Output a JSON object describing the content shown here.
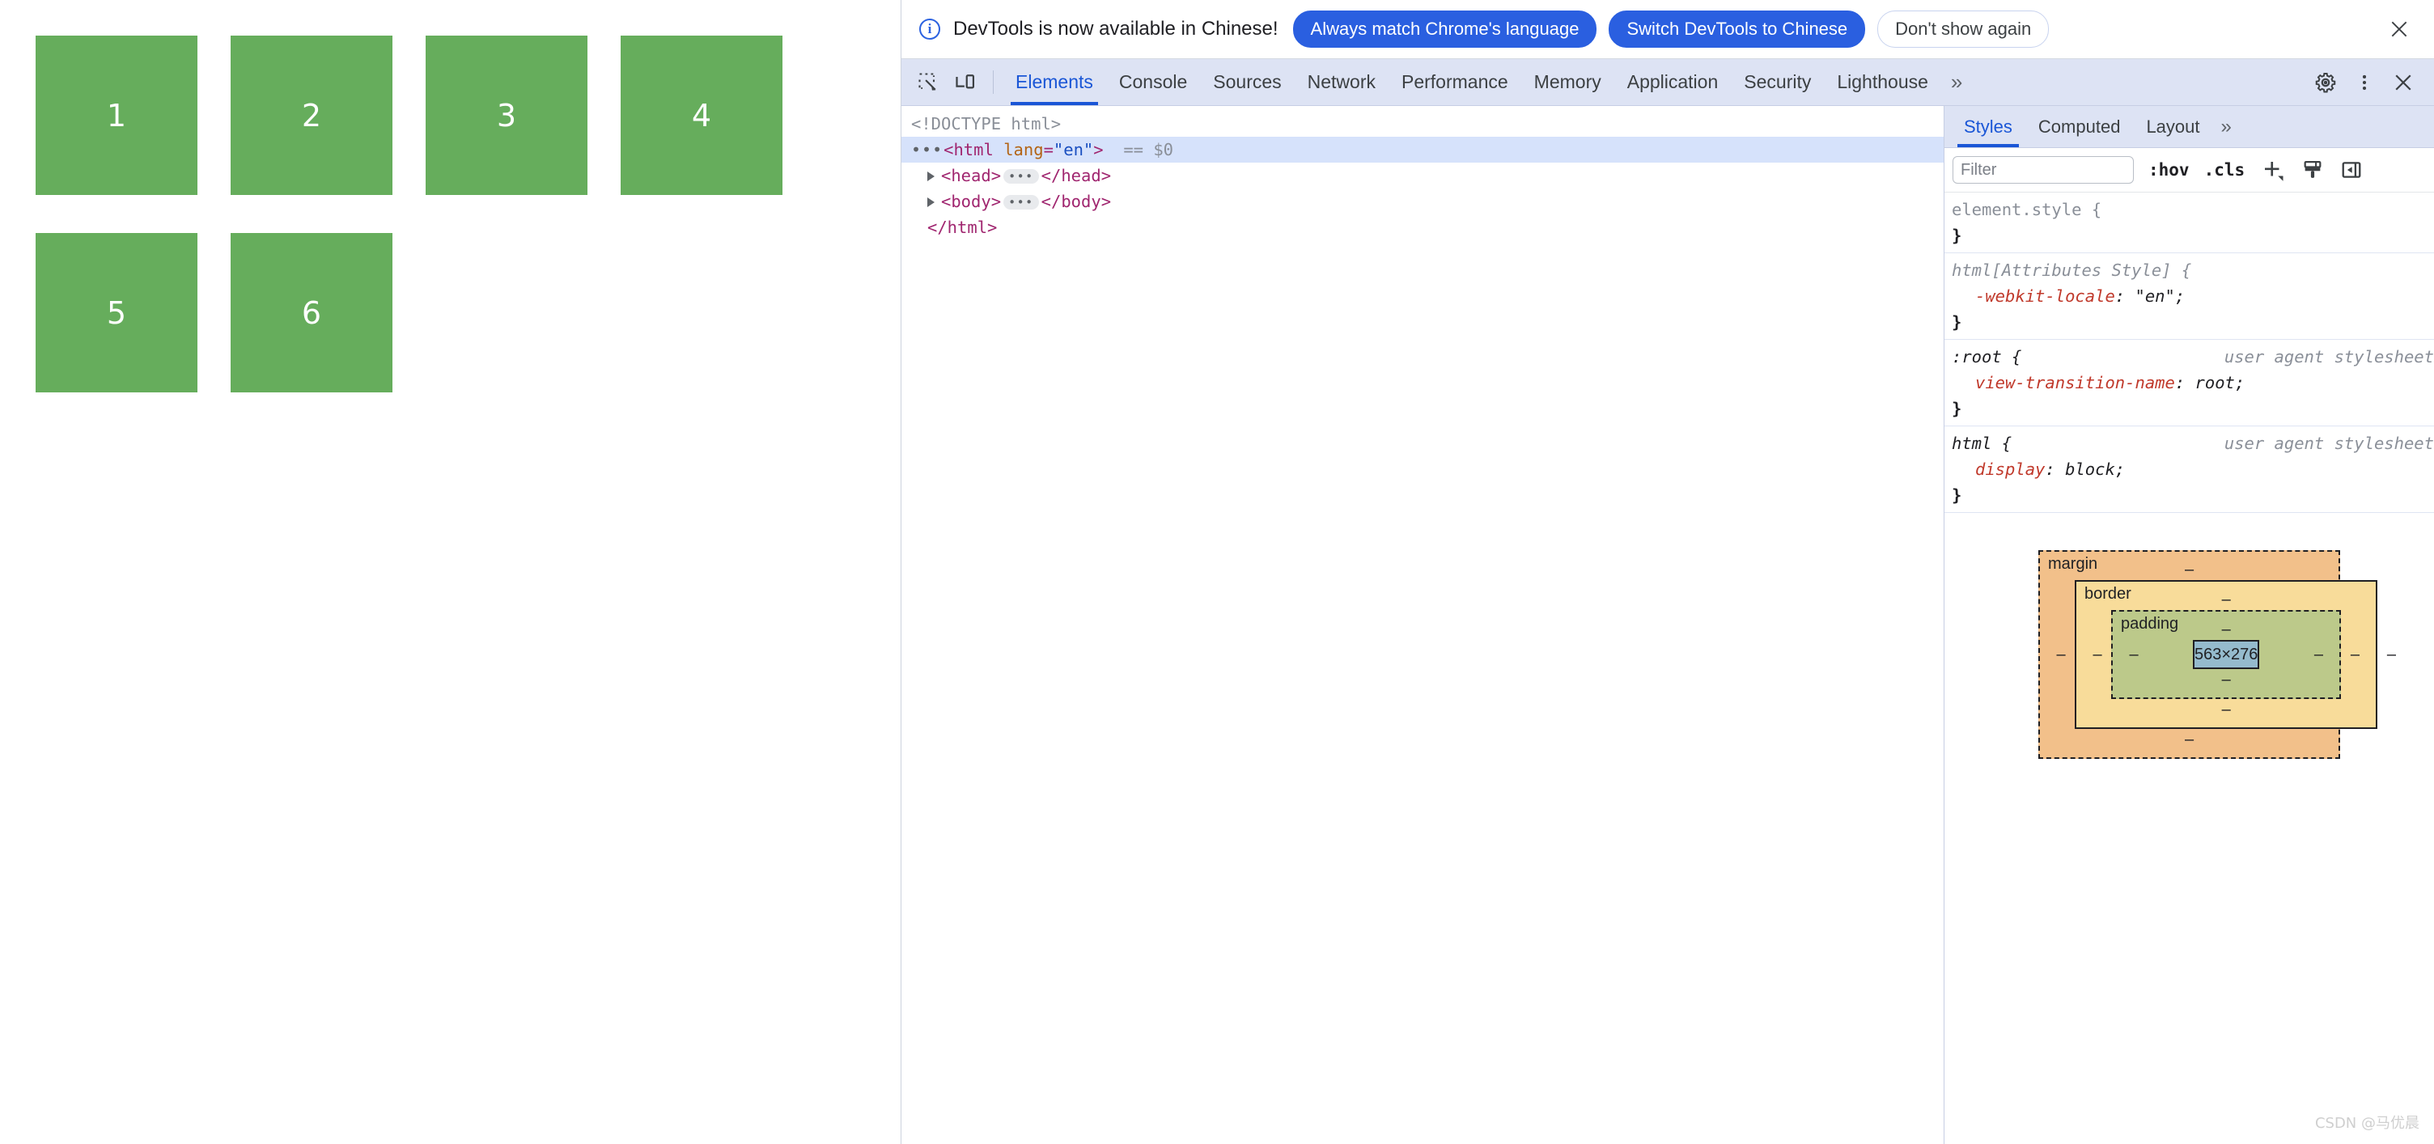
{
  "page": {
    "boxes": [
      {
        "label": "1"
      },
      {
        "label": "2"
      },
      {
        "label": "3"
      },
      {
        "label": "4"
      },
      {
        "label": "5"
      },
      {
        "label": "6"
      }
    ],
    "box_color": "#66ad5c",
    "box_text_color": "#ffffff"
  },
  "infobar": {
    "icon": "info-circle-icon",
    "message": "DevTools is now available in Chinese!",
    "primary_button_1": "Always match Chrome's language",
    "primary_button_2": "Switch DevTools to Chinese",
    "ghost_button": "Don't show again",
    "close_icon": "close-icon",
    "accent_color": "#2a5fe0"
  },
  "tabstrip": {
    "inspect_icon": "inspect-element-icon",
    "device_icon": "device-toolbar-icon",
    "tabs": [
      {
        "label": "Elements",
        "active": true
      },
      {
        "label": "Console",
        "active": false
      },
      {
        "label": "Sources",
        "active": false
      },
      {
        "label": "Network",
        "active": false
      },
      {
        "label": "Performance",
        "active": false
      },
      {
        "label": "Memory",
        "active": false
      },
      {
        "label": "Application",
        "active": false
      },
      {
        "label": "Security",
        "active": false
      },
      {
        "label": "Lighthouse",
        "active": false
      }
    ],
    "more_tabs": "»",
    "settings_icon": "gear-icon",
    "menu_icon": "more-vertical-icon",
    "close_icon": "close-icon",
    "active_color": "#1a56d6"
  },
  "dom": {
    "rows": [
      {
        "kind": "doctype",
        "text": "<!DOCTYPE html>"
      },
      {
        "kind": "selected_html",
        "dots": "•••",
        "open": "<html",
        "attr_name": "lang",
        "attr_value": "\"en\"",
        "close": ">",
        "suffix": "== $0"
      },
      {
        "kind": "element",
        "open": "<head>",
        "badge": "•••",
        "close": "</head>"
      },
      {
        "kind": "element",
        "open": "<body>",
        "badge": "•••",
        "close": "</body>"
      },
      {
        "kind": "closing",
        "text": "</html>"
      }
    ]
  },
  "styles_sidebar": {
    "tabs": [
      {
        "label": "Styles",
        "active": true
      },
      {
        "label": "Computed",
        "active": false
      },
      {
        "label": "Layout",
        "active": false
      }
    ],
    "more_tabs": "»",
    "filter_placeholder": "Filter",
    "filter_value": "",
    "hov_label": ":hov",
    "cls_label": ".cls",
    "new_rule_icon": "plus-dropdown-icon",
    "style_pane_icon": "paint-brush-icon",
    "toggle_sidebar_icon": "toggle-sidebar-icon",
    "rules": [
      {
        "selector": "element.style",
        "selector_style": "grayed",
        "origin": "",
        "declarations": []
      },
      {
        "selector": "html[Attributes Style]",
        "selector_style": "grayed-italic",
        "origin": "",
        "declarations": [
          {
            "property": "-webkit-locale",
            "value": "\"en\";"
          }
        ]
      },
      {
        "selector": ":root",
        "selector_style": "italic",
        "origin": "user agent stylesheet",
        "declarations": [
          {
            "property": "view-transition-name",
            "value": "root;"
          }
        ]
      },
      {
        "selector": "html",
        "selector_style": "italic",
        "origin": "user agent stylesheet",
        "declarations": [
          {
            "property": "display",
            "value": "block;"
          }
        ]
      }
    ]
  },
  "box_model": {
    "margin_label": "margin",
    "border_label": "border",
    "padding_label": "padding",
    "content_size": "563×276",
    "margin_top": "–",
    "margin_bottom": "–",
    "margin_left": "–",
    "margin_right": "–",
    "border_top": "–",
    "border_bottom": "–",
    "border_left": "–",
    "border_right": "–",
    "padding_top": "–",
    "padding_bottom": "–",
    "padding_left": "–",
    "padding_right": "–",
    "colors": {
      "margin": "#f2c08a",
      "border": "#f8dc9a",
      "padding": "#bcc98a",
      "content": "#95bbcd"
    }
  },
  "watermark": {
    "text": "CSDN @马优晨"
  }
}
